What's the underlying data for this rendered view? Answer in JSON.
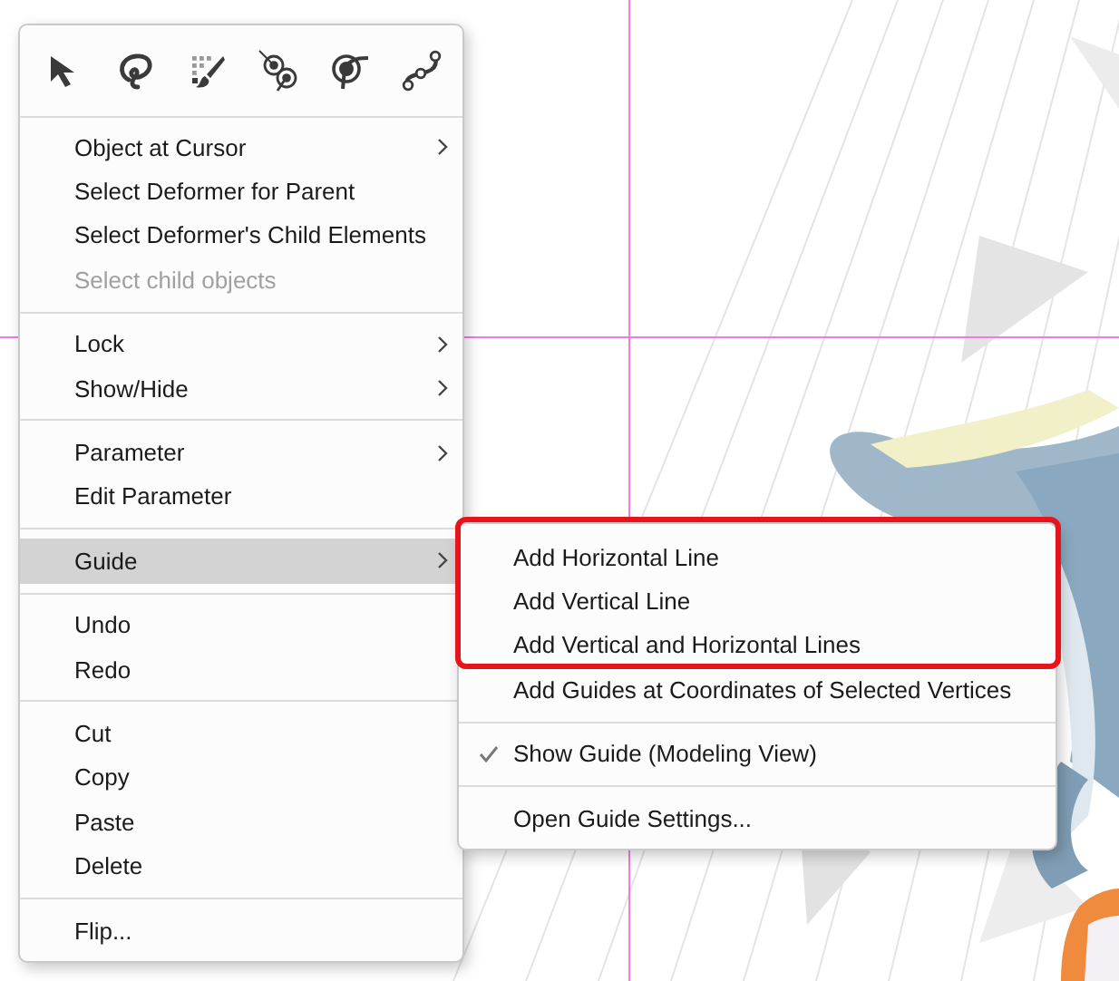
{
  "context_menu": {
    "tools": [
      {
        "kind": "pointer"
      },
      {
        "kind": "lasso"
      },
      {
        "kind": "brush"
      },
      {
        "kind": "bind"
      },
      {
        "kind": "pin"
      },
      {
        "kind": "path"
      }
    ],
    "sections": [
      {
        "items": [
          {
            "label": "Object at Cursor",
            "submenu": true,
            "disabled": false,
            "selected": false
          },
          {
            "label": "Select Deformer for Parent",
            "submenu": false,
            "disabled": false,
            "selected": false
          },
          {
            "label": "Select Deformer's Child Elements",
            "submenu": false,
            "disabled": false,
            "selected": false
          },
          {
            "label": "Select child objects",
            "submenu": false,
            "disabled": true,
            "selected": false
          }
        ]
      },
      {
        "items": [
          {
            "label": "Lock",
            "submenu": true,
            "disabled": false,
            "selected": false
          },
          {
            "label": "Show/Hide",
            "submenu": true,
            "disabled": false,
            "selected": false
          }
        ]
      },
      {
        "items": [
          {
            "label": "Parameter",
            "submenu": true,
            "disabled": false,
            "selected": false
          },
          {
            "label": "Edit Parameter",
            "submenu": false,
            "disabled": false,
            "selected": false
          }
        ]
      },
      {
        "items": [
          {
            "label": "Guide",
            "submenu": true,
            "disabled": false,
            "selected": true
          }
        ]
      },
      {
        "items": [
          {
            "label": "Undo",
            "submenu": false,
            "disabled": false,
            "selected": false
          },
          {
            "label": "Redo",
            "submenu": false,
            "disabled": false,
            "selected": false
          }
        ]
      },
      {
        "items": [
          {
            "label": "Cut",
            "submenu": false,
            "disabled": false,
            "selected": false
          },
          {
            "label": "Copy",
            "submenu": false,
            "disabled": false,
            "selected": false
          },
          {
            "label": "Paste",
            "submenu": false,
            "disabled": false,
            "selected": false
          },
          {
            "label": "Delete",
            "submenu": false,
            "disabled": false,
            "selected": false
          }
        ]
      },
      {
        "items": [
          {
            "label": "Flip...",
            "submenu": false,
            "disabled": false,
            "selected": false
          }
        ]
      }
    ]
  },
  "guide_submenu": {
    "sections": [
      {
        "highlighted": true,
        "items": [
          {
            "label": "Add Horizontal Line",
            "checked": false
          },
          {
            "label": "Add Vertical Line",
            "checked": false
          },
          {
            "label": "Add Vertical and Horizontal Lines",
            "checked": false
          }
        ]
      },
      {
        "highlighted": false,
        "items": [
          {
            "label": "Add Guides at Coordinates of Selected Vertices",
            "checked": false
          }
        ]
      },
      {
        "highlighted": false,
        "items": [
          {
            "label": "Show Guide (Modeling View)",
            "checked": true
          }
        ]
      },
      {
        "highlighted": false,
        "items": [
          {
            "label": "Open Guide Settings...",
            "checked": false
          }
        ]
      }
    ]
  }
}
